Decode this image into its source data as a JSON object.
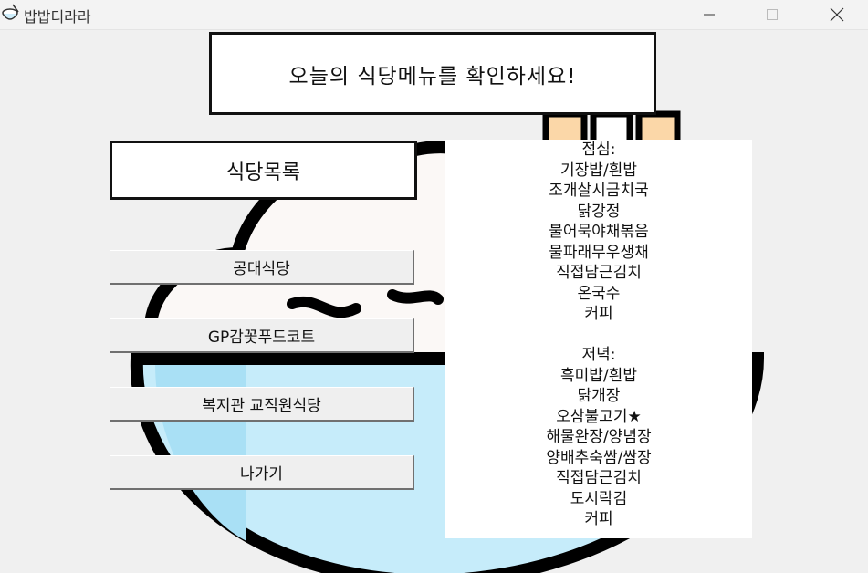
{
  "window": {
    "title": "밥밥디라라",
    "controls": {
      "minimize": "—",
      "maximize": "☐",
      "close": "✕"
    }
  },
  "header": {
    "text": "오늘의 식당메뉴를 확인하세요!"
  },
  "sidebar": {
    "title": "식당목록",
    "buttons": [
      "공대식당",
      "GP감꽃푸드코트",
      "복지관 교직원식당",
      "나가기"
    ]
  },
  "menu": {
    "lunch_label": "점심:",
    "lunch_items": [
      "기장밥/흰밥",
      "조개살시금치국",
      "닭강정",
      "불어묵야채볶음",
      "물파래무우생채",
      "직접담근김치",
      "온국수",
      "커피"
    ],
    "dinner_label": "저녁:",
    "dinner_items": [
      "흑미밥/흰밥",
      "닭개장",
      "오삼불고기★",
      "해물완장/양념장",
      "양배추숙쌈/쌈장",
      "직접담근김치",
      "도시락김",
      "커피"
    ]
  },
  "icons": {
    "app": "rice-bowl-icon"
  },
  "colors": {
    "bowl_blue": "#c6ecfa",
    "outline": "#000000",
    "chopstick_peach": "#fbd7a8"
  }
}
